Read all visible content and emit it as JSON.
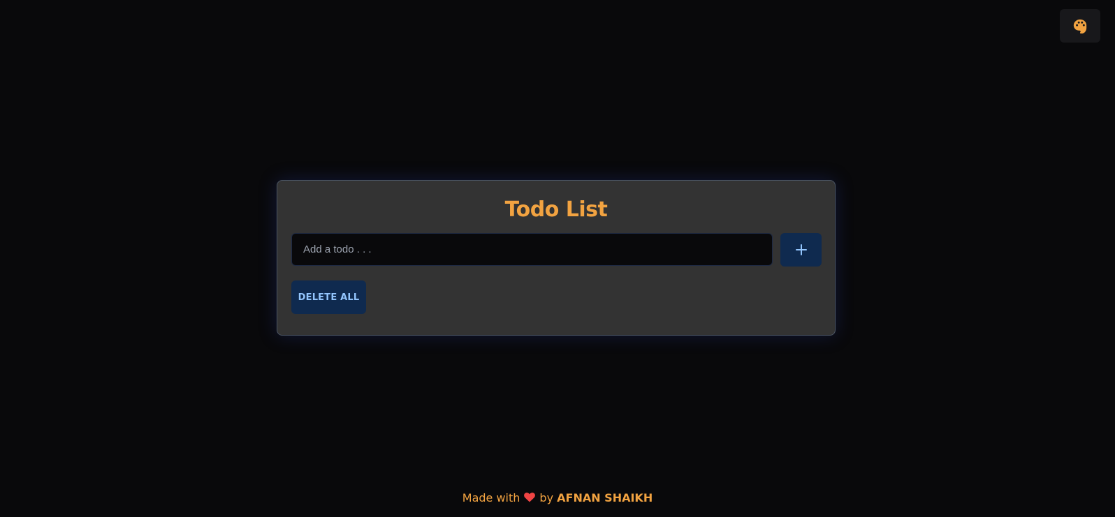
{
  "theme": {
    "icon": "palette-icon",
    "accent": "#f2a341",
    "button_blue_bg": "#0f2a4f",
    "button_blue_text": "#93c5fd",
    "card_bg": "#333333",
    "page_bg": "#09090b"
  },
  "card": {
    "title": "Todo List",
    "input_placeholder": "Add a todo . . .",
    "input_value": "",
    "add_icon": "plus-icon",
    "delete_all_label": "DELETE ALL"
  },
  "footer": {
    "made_with": "Made with",
    "heart_icon": "heart-icon",
    "by": "by",
    "author": "AFNAN SHAIKH"
  }
}
